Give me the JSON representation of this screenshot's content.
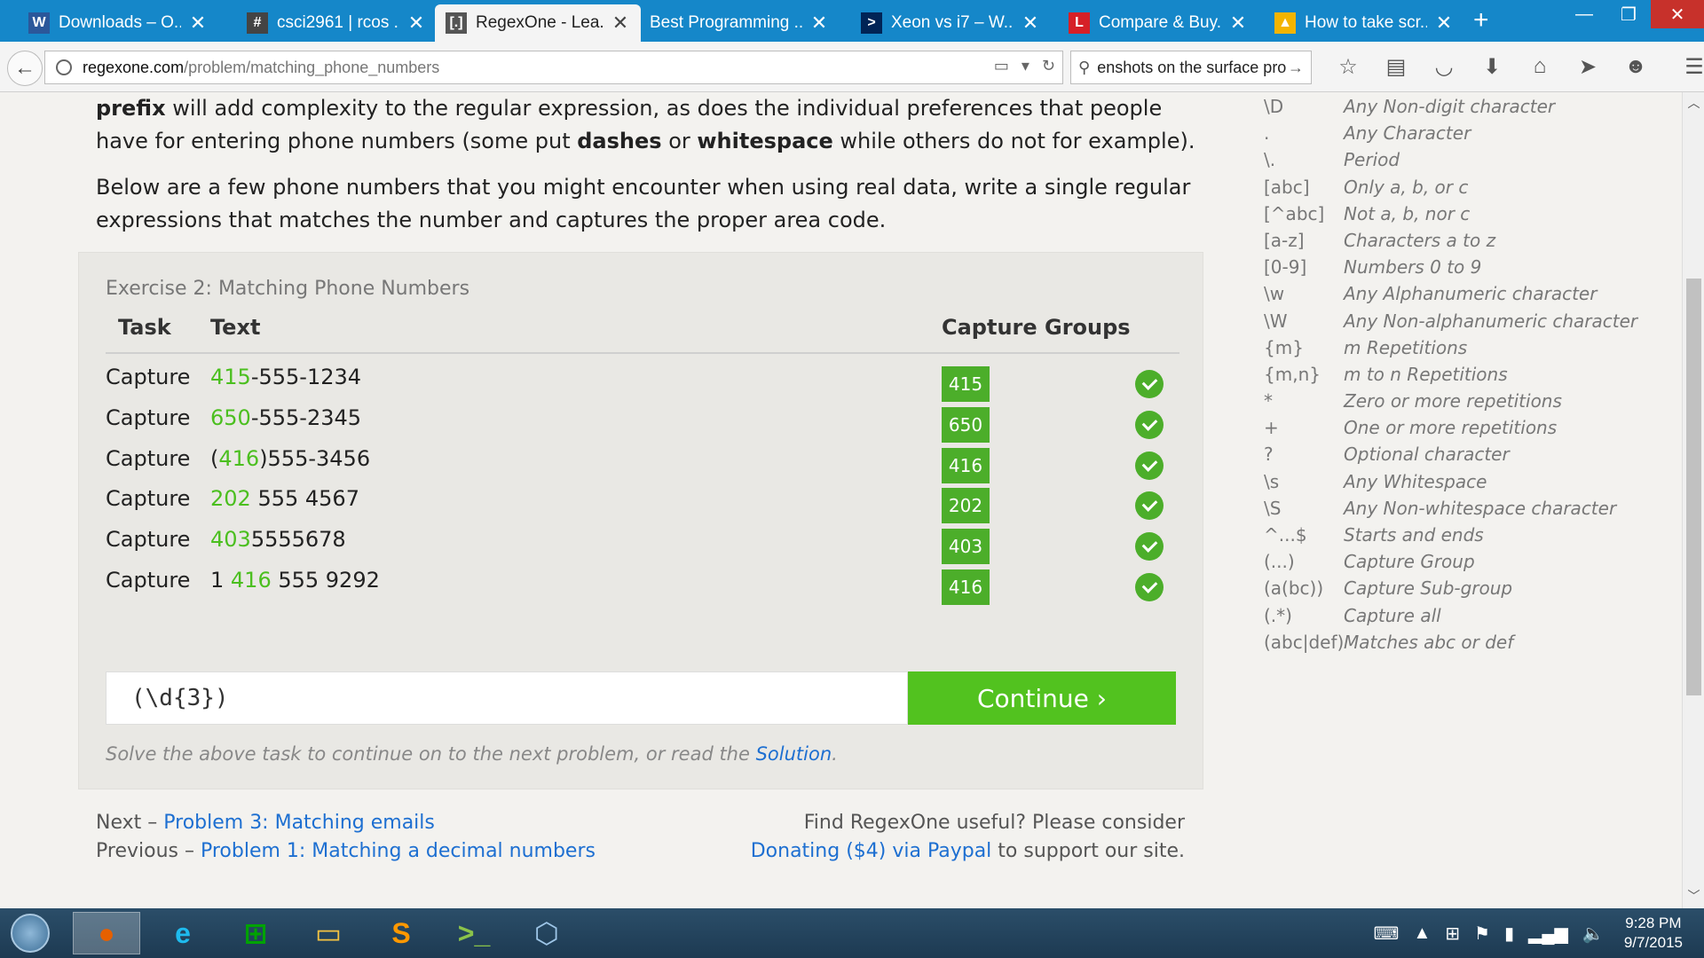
{
  "browser": {
    "tabs": [
      {
        "label": "Downloads – O...",
        "icon": "word-doc-icon",
        "fav": "W",
        "favcolor": "#2b579a"
      },
      {
        "label": "csci2961 | rcos ...",
        "icon": "hash-icon",
        "fav": "#",
        "favcolor": "#444444"
      },
      {
        "label": "RegexOne - Lea...",
        "icon": "regexone-icon",
        "fav": "[.]",
        "favcolor": "#555555",
        "active": true
      },
      {
        "label": "Best Programming ...",
        "icon": "",
        "fav": "",
        "favcolor": ""
      },
      {
        "label": "Xeon vs i7 – W...",
        "icon": "powershell-icon",
        "fav": ">",
        "favcolor": "#012456"
      },
      {
        "label": "Compare & Buy...",
        "icon": "l-logo-icon",
        "fav": "L",
        "favcolor": "#d62027"
      },
      {
        "label": "How to take scr...",
        "icon": "google-drive-icon",
        "fav": "▲",
        "favcolor": "#f4b400"
      }
    ],
    "url_host": "regexone.com",
    "url_path": "/problem/matching_phone_numbers",
    "search_text": "enshots on the surface pro"
  },
  "article": {
    "p1_b1": "prefix",
    "p1_t1": " will add complexity to the regular expression, as does the individual preferences that people have for entering phone numbers (some put ",
    "p1_b2": "dashes",
    "p1_t2": " or ",
    "p1_b3": "whitespace",
    "p1_t3": " while others do not for example).",
    "p2": "Below are a few phone numbers that you might encounter when using real data, write a single regular expressions that matches the number and captures the proper area code."
  },
  "exercise": {
    "title": "Exercise 2: Matching Phone Numbers",
    "col_task": "Task",
    "col_text": "Text",
    "col_capture": "Capture Groups",
    "rows": [
      {
        "task": "Capture",
        "pre": "",
        "hl": "415",
        "post": "-555-1234",
        "group": "415"
      },
      {
        "task": "Capture",
        "pre": "",
        "hl": "650",
        "post": "-555-2345",
        "group": "650"
      },
      {
        "task": "Capture",
        "pre": "(",
        "hl": "416",
        "post": ")555-3456",
        "group": "416"
      },
      {
        "task": "Capture",
        "pre": "",
        "hl": "202",
        "post": " 555 4567",
        "group": "202"
      },
      {
        "task": "Capture",
        "pre": "",
        "hl": "403",
        "post": "5555678",
        "group": "403"
      },
      {
        "task": "Capture",
        "pre": "1 ",
        "hl": "416",
        "post": " 555 9292",
        "group": "416"
      }
    ],
    "answer": "(\\d{3})",
    "continue_label": "Continue ›",
    "hint_text": "Solve the above task to continue on to the next problem, or read the ",
    "hint_link": "Solution",
    "hint_end": "."
  },
  "footer": {
    "next_prefix": "Next – ",
    "next_link": "Problem 3: Matching emails",
    "prev_prefix": "Previous – ",
    "prev_link": "Problem 1: Matching a decimal numbers",
    "donate_line1": "Find RegexOne useful? Please consider",
    "donate_link": "Donating ($4) via Paypal",
    "donate_end": " to support our site."
  },
  "cheatsheet": [
    {
      "sym": "\\D",
      "desc": "Any Non-digit character"
    },
    {
      "sym": ".",
      "desc": "Any Character"
    },
    {
      "sym": "\\.",
      "desc": "Period"
    },
    {
      "sym": "[abc]",
      "desc": "Only a, b, or c"
    },
    {
      "sym": "[^abc]",
      "desc": "Not a, b, nor c"
    },
    {
      "sym": "[a-z]",
      "desc": "Characters a to z"
    },
    {
      "sym": "[0-9]",
      "desc": "Numbers 0 to 9"
    },
    {
      "sym": "\\w",
      "desc": "Any Alphanumeric character"
    },
    {
      "sym": "\\W",
      "desc": "Any Non-alphanumeric character"
    },
    {
      "sym": "{m}",
      "desc": "m Repetitions"
    },
    {
      "sym": "{m,n}",
      "desc": "m to n Repetitions"
    },
    {
      "sym": "*",
      "desc": "Zero or more repetitions"
    },
    {
      "sym": "+",
      "desc": "One or more repetitions"
    },
    {
      "sym": "?",
      "desc": "Optional character"
    },
    {
      "sym": "\\s",
      "desc": "Any Whitespace"
    },
    {
      "sym": "\\S",
      "desc": "Any Non-whitespace character"
    },
    {
      "sym": "^...$",
      "desc": "Starts and ends"
    },
    {
      "sym": "(...)",
      "desc": "Capture Group"
    },
    {
      "sym": "(a(bc))",
      "desc": "Capture Sub-group"
    },
    {
      "sym": "(.*)",
      "desc": "Capture all"
    },
    {
      "sym": "(abc|def)",
      "desc": "Matches abc or def"
    }
  ],
  "taskbar": {
    "apps": [
      "firefox-icon",
      "internet-explorer-icon",
      "windows-store-icon",
      "file-explorer-icon",
      "sublime-text-icon",
      "terminal-icon",
      "virtualbox-icon"
    ],
    "time": "9:28 PM",
    "date": "9/7/2015"
  },
  "colors": {
    "accent_green": "#52c21f",
    "highlight_green": "#4bbf1f",
    "link_blue": "#1d6fd1",
    "tabbar_blue": "#1587c9"
  }
}
